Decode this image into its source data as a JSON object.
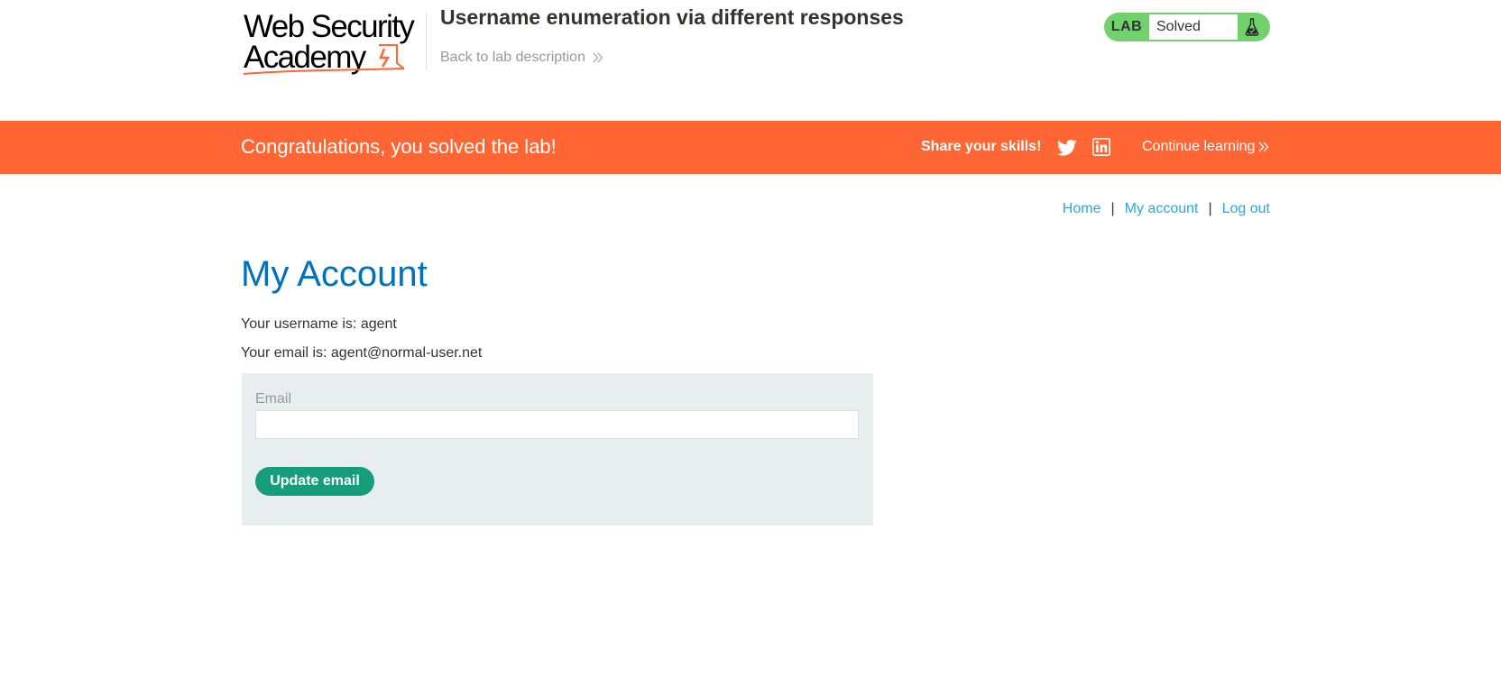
{
  "header": {
    "logo_line1": "Web Security",
    "logo_line2": "Academy",
    "lab_title": "Username enumeration via different responses",
    "back_link": "Back to lab description"
  },
  "lab_status": {
    "label": "LAB",
    "status": "Solved",
    "icon": "flask-icon",
    "color": "#70d16d"
  },
  "banner": {
    "message": "Congratulations, you solved the lab!",
    "share_label": "Share your skills!",
    "share_icons": [
      "twitter-icon",
      "linkedin-icon"
    ],
    "continue_label": "Continue learning",
    "color": "#ff6633"
  },
  "nav": {
    "items": [
      "Home",
      "My account",
      "Log out"
    ],
    "separator": "|"
  },
  "account": {
    "title": "My Account",
    "username_line": "Your username is: agent",
    "email_line": "Your email is: agent@normal-user.net"
  },
  "form": {
    "email_label": "Email",
    "email_value": "",
    "submit_label": "Update email",
    "button_color": "#159d7c"
  }
}
